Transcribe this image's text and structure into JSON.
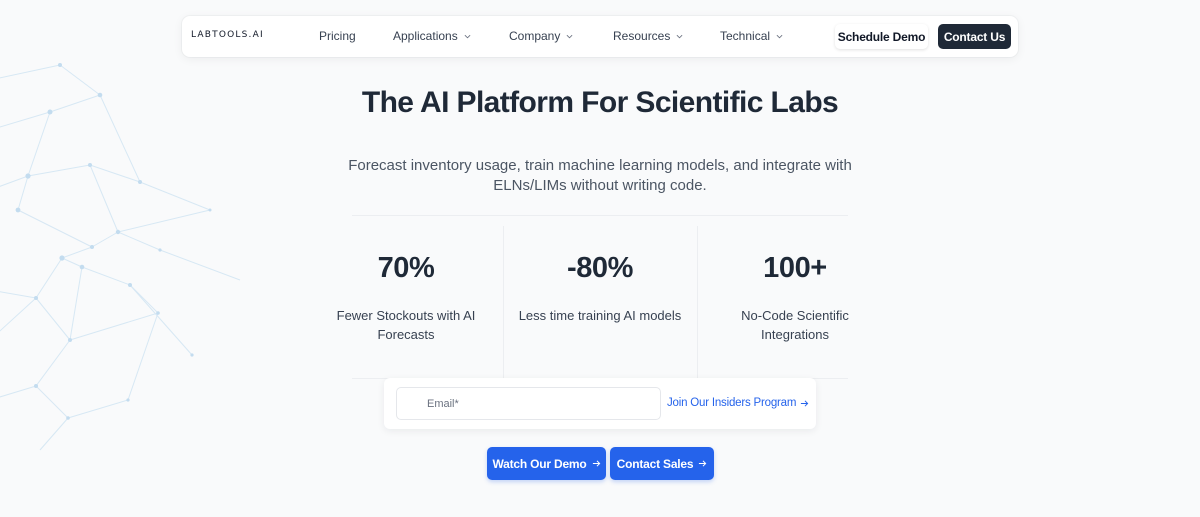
{
  "nav": {
    "logo": "LABTOOLS.AI",
    "items": [
      {
        "label": "Pricing",
        "dropdown": false
      },
      {
        "label": "Applications",
        "dropdown": true
      },
      {
        "label": "Company",
        "dropdown": true
      },
      {
        "label": "Resources",
        "dropdown": true
      },
      {
        "label": "Technical",
        "dropdown": true
      }
    ],
    "schedule_demo": "Schedule Demo",
    "contact_us": "Contact Us"
  },
  "hero": {
    "title": "The AI Platform For Scientific Labs",
    "subtitle": "Forecast inventory usage, train machine learning models, and integrate with ELNs/LIMs without writing code."
  },
  "stats": [
    {
      "value": "70%",
      "label": "Fewer Stockouts with AI Forecasts"
    },
    {
      "value": "-80%",
      "label": "Less time training AI models"
    },
    {
      "value": "100+",
      "label": "No-Code Scientific Integrations"
    }
  ],
  "signup": {
    "email_placeholder": "Email*",
    "email_value": "",
    "join_label": "Join Our Insiders Program"
  },
  "cta": {
    "watch_demo": "Watch Our Demo",
    "contact_sales": "Contact Sales"
  },
  "colors": {
    "accent": "#2563eb",
    "dark_button": "#1f2937",
    "background": "#f9fafb",
    "network_lines": "#cfe3f2"
  },
  "icons": {
    "dropdown": "chevron-down-icon",
    "link_arrow": "arrow-right-icon"
  }
}
